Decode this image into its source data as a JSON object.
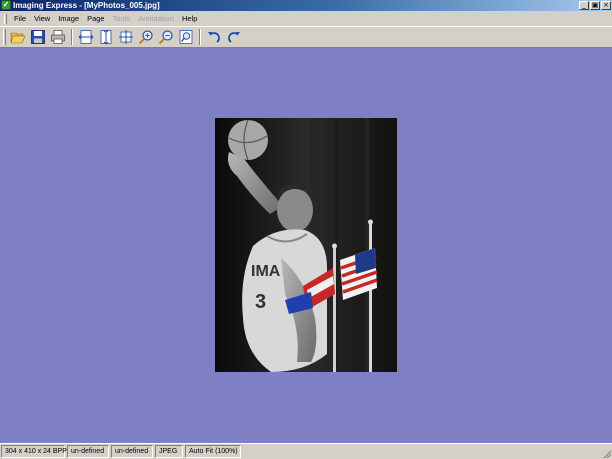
{
  "window": {
    "title": "Imaging Express - [MyPhotos_005.jpg]",
    "app_icon_glyph": "✓",
    "controls": {
      "minimize": "_",
      "restore": "▣",
      "close": "×"
    }
  },
  "menu": {
    "items": [
      {
        "label": "File",
        "enabled": true
      },
      {
        "label": "View",
        "enabled": true
      },
      {
        "label": "Image",
        "enabled": true
      },
      {
        "label": "Page",
        "enabled": true
      },
      {
        "label": "Tools",
        "enabled": false
      },
      {
        "label": "Annotation",
        "enabled": false
      },
      {
        "label": "Help",
        "enabled": true
      }
    ]
  },
  "toolbar": {
    "buttons": [
      "open-icon",
      "save-icon",
      "print-icon",
      "fit-width-icon",
      "fit-height-icon",
      "fit-window-icon",
      "zoom-in-icon",
      "zoom-out-icon",
      "actual-size-icon",
      "rotate-left-icon",
      "rotate-right-icon"
    ]
  },
  "canvas": {
    "background": "#7f7fc4"
  },
  "status": {
    "dimensions": "304 x 410 x 24 BPP",
    "field2": "un-defined",
    "field3": "un-defined",
    "format": "JPEG",
    "zoom": "Auto Fit (100%)"
  }
}
